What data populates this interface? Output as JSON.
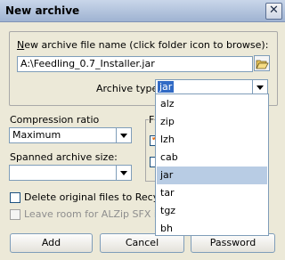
{
  "window": {
    "title": "New archive",
    "close_glyph": "✕"
  },
  "file_name": {
    "label_prefix": "",
    "label_mnemonic": "N",
    "label_rest": "ew archive file name (click folder icon to browse):",
    "value": "A:\\Feedling_0.7_Installer.jar",
    "folder_icon": "folder-open-icon"
  },
  "archive_type": {
    "label": "Archive type",
    "selected": "jar",
    "options": [
      "alz",
      "zip",
      "lzh",
      "cab",
      "jar",
      "tar",
      "tgz",
      "bh"
    ],
    "highlighted_index": 4
  },
  "compression": {
    "label": "Compression ratio",
    "value": "Maximum"
  },
  "spanned": {
    "label": "Spanned archive size:",
    "value": ""
  },
  "format_group": {
    "label_fragment": "F"
  },
  "delete_originals": {
    "label": "Delete original files to Recyc",
    "checked": false
  },
  "sfx_room": {
    "label": "Leave room for ALZip SFX in",
    "checked": false,
    "disabled": true
  },
  "buttons": {
    "add": "Add",
    "cancel": "Cancel",
    "password": "Password"
  },
  "colors": {
    "highlight": "#b8cce4",
    "selected": "#316ac5",
    "border": "#7f9db9"
  }
}
